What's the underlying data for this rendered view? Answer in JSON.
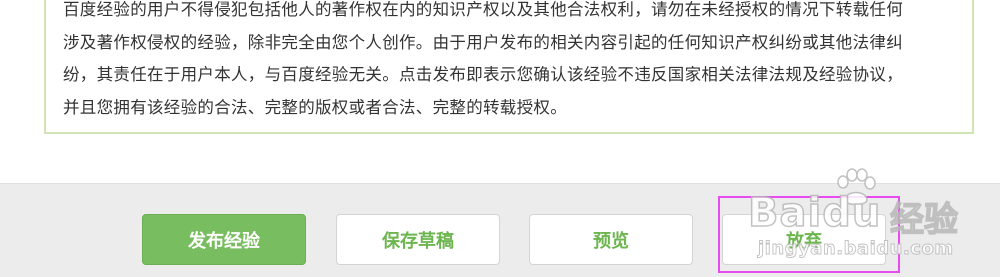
{
  "notice": {
    "lines": [
      "百度经验的用户不得侵犯包括他人的著作权在内的知识产权以及其他合法权利，请勿在未经授权的情况下转载任何",
      "涉及著作权侵权的经验，除非完全由您个人创作。由于用户发布的相关内容引起的任何知识产权纠纷或其他法律纠",
      "纷，其责任在于用户本人，与百度经验无关。点击发布即表示您确认该经验不违反国家相关法律法规及经验协议，",
      "并且您拥有该经验的合法、完整的版权或者合法、完整的转载授权。"
    ]
  },
  "actions": {
    "publish_label": "发布经验",
    "draft_label": "保存草稿",
    "preview_label": "预览",
    "discard_label": "放弃"
  },
  "watermark": {
    "logo": "Baidu",
    "suffix": "经验",
    "url": "jingyan.baidu.com"
  },
  "colors": {
    "accent": "#79bd61",
    "accent_text": "#6db64f",
    "notice_border": "#cfe6b4",
    "highlight": "#e84cf0"
  }
}
